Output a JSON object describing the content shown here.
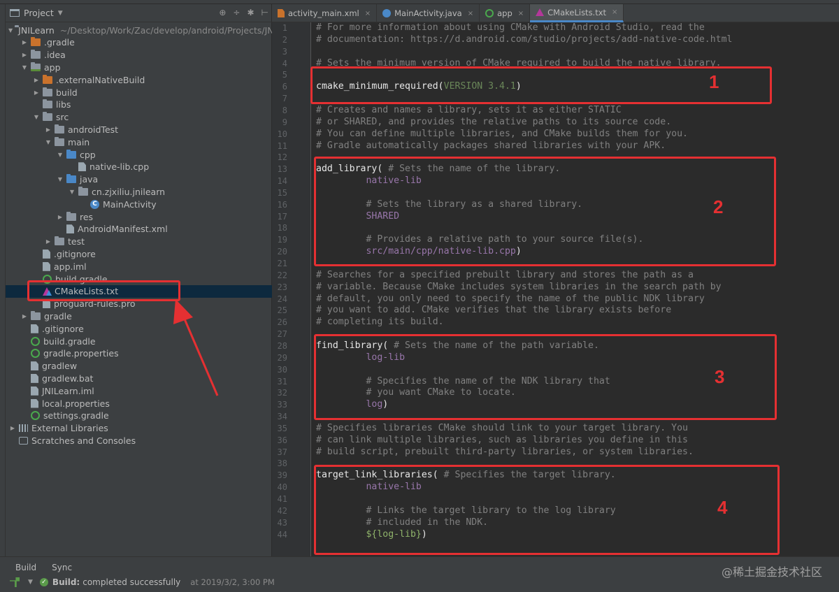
{
  "project_panel": {
    "title": "Project",
    "tools": [
      "⊕",
      "÷",
      "✱",
      "⊢"
    ]
  },
  "tree": [
    {
      "label": "JNILearn",
      "note": "~/Desktop/Work/Zac/develop/android/Projects/JNI",
      "icon": "module-folder-icon",
      "level": 0,
      "arrow": "▼"
    },
    {
      "label": ".gradle",
      "icon": "orange-folder-icon",
      "level": 1,
      "arrow": "▶"
    },
    {
      "label": ".idea",
      "icon": "folder-icon",
      "level": 1,
      "arrow": "▶"
    },
    {
      "label": "app",
      "icon": "module-folder-icon",
      "level": 1,
      "arrow": "▼"
    },
    {
      "label": ".externalNativeBuild",
      "icon": "orange-folder-icon",
      "level": 2,
      "arrow": "▶"
    },
    {
      "label": "build",
      "icon": "folder-icon",
      "level": 2,
      "arrow": "▶"
    },
    {
      "label": "libs",
      "icon": "folder-icon",
      "level": 2,
      "arrow": ""
    },
    {
      "label": "src",
      "icon": "folder-icon",
      "level": 2,
      "arrow": "▼"
    },
    {
      "label": "androidTest",
      "icon": "folder-icon",
      "level": 3,
      "arrow": "▶"
    },
    {
      "label": "main",
      "icon": "folder-icon",
      "level": 3,
      "arrow": "▼"
    },
    {
      "label": "cpp",
      "icon": "blue-folder-icon",
      "level": 4,
      "arrow": "▼"
    },
    {
      "label": "native-lib.cpp",
      "icon": "file-icon",
      "level": 5,
      "arrow": ""
    },
    {
      "label": "java",
      "icon": "blue-folder-icon",
      "level": 4,
      "arrow": "▼"
    },
    {
      "label": "cn.zjxiliu.jnilearn",
      "icon": "folder-icon",
      "level": 5,
      "arrow": "▼"
    },
    {
      "label": "MainActivity",
      "icon": "class-icon",
      "level": 6,
      "arrow": ""
    },
    {
      "label": "res",
      "icon": "folder-icon",
      "level": 4,
      "arrow": "▶"
    },
    {
      "label": "AndroidManifest.xml",
      "icon": "file-icon",
      "level": 4,
      "arrow": ""
    },
    {
      "label": "test",
      "icon": "folder-icon",
      "level": 3,
      "arrow": "▶"
    },
    {
      "label": ".gitignore",
      "icon": "file-icon",
      "level": 2,
      "arrow": ""
    },
    {
      "label": "app.iml",
      "icon": "file-icon",
      "level": 2,
      "arrow": ""
    },
    {
      "label": "build.gradle",
      "icon": "gradle-icon",
      "level": 2,
      "arrow": ""
    },
    {
      "label": "CMakeLists.txt",
      "icon": "cmake-icon",
      "level": 2,
      "arrow": "",
      "selected": true
    },
    {
      "label": "proguard-rules.pro",
      "icon": "file-icon",
      "level": 2,
      "arrow": ""
    },
    {
      "label": "gradle",
      "icon": "folder-icon",
      "level": 1,
      "arrow": "▶"
    },
    {
      "label": ".gitignore",
      "icon": "file-icon",
      "level": 1,
      "arrow": ""
    },
    {
      "label": "build.gradle",
      "icon": "gradle-icon",
      "level": 1,
      "arrow": ""
    },
    {
      "label": "gradle.properties",
      "icon": "gradle-icon",
      "level": 1,
      "arrow": ""
    },
    {
      "label": "gradlew",
      "icon": "file-icon",
      "level": 1,
      "arrow": ""
    },
    {
      "label": "gradlew.bat",
      "icon": "file-icon",
      "level": 1,
      "arrow": ""
    },
    {
      "label": "JNILearn.iml",
      "icon": "file-icon",
      "level": 1,
      "arrow": ""
    },
    {
      "label": "local.properties",
      "icon": "file-icon",
      "level": 1,
      "arrow": ""
    },
    {
      "label": "settings.gradle",
      "icon": "gradle-icon",
      "level": 1,
      "arrow": ""
    },
    {
      "label": "External Libraries",
      "icon": "library-icon",
      "level": 0,
      "arrow": "▶"
    },
    {
      "label": "Scratches and Consoles",
      "icon": "scratch-icon",
      "level": 0,
      "arrow": ""
    }
  ],
  "tabs": [
    {
      "label": "activity_main.xml",
      "icon": "xml-file-icon",
      "active": false
    },
    {
      "label": "MainActivity.java",
      "icon": "class-icon",
      "active": false
    },
    {
      "label": "app",
      "icon": "gradle-icon",
      "active": false
    },
    {
      "label": "CMakeLists.txt",
      "icon": "cmake-icon",
      "active": true
    }
  ],
  "tab_close_glyph": "×",
  "code_lines": [
    [
      [
        "com",
        "# For more information about using CMake with Android Studio, read the"
      ]
    ],
    [
      [
        "com",
        "# documentation: https://d.android.com/studio/projects/add-native-code.html"
      ]
    ],
    [],
    [
      [
        "com",
        "# Sets the minimum version of CMake required to build the native library."
      ]
    ],
    [],
    [
      [
        "cmd",
        "cmake_minimum_required("
      ],
      [
        "ver",
        "VERSION 3.4.1"
      ],
      [
        "cmd",
        ")"
      ]
    ],
    [],
    [
      [
        "com",
        "# Creates and names a library, sets it as either STATIC"
      ]
    ],
    [
      [
        "com",
        "# or SHARED, and provides the relative paths to its source code."
      ]
    ],
    [
      [
        "com",
        "# You can define multiple libraries, and CMake builds them for you."
      ]
    ],
    [
      [
        "com",
        "# Gradle automatically packages shared libraries with your APK."
      ]
    ],
    [],
    [
      [
        "cmd",
        "add_library( "
      ],
      [
        "com",
        "# Sets the name of the library."
      ]
    ],
    [
      [
        "arg",
        "         native-lib"
      ]
    ],
    [],
    [
      [
        "com",
        "         # Sets the library as a shared library."
      ]
    ],
    [
      [
        "arg",
        "         SHARED"
      ]
    ],
    [],
    [
      [
        "com",
        "         # Provides a relative path to your source file(s)."
      ]
    ],
    [
      [
        "arg",
        "         src/main/cpp/native-lib.cpp"
      ],
      [
        "cmd",
        ")"
      ]
    ],
    [],
    [
      [
        "com",
        "# Searches for a specified prebuilt library and stores the path as a"
      ]
    ],
    [
      [
        "com",
        "# variable. Because CMake includes system libraries in the search path by"
      ]
    ],
    [
      [
        "com",
        "# default, you only need to specify the name of the public NDK library"
      ]
    ],
    [
      [
        "com",
        "# you want to add. CMake verifies that the library exists before"
      ]
    ],
    [
      [
        "com",
        "# completing its build."
      ]
    ],
    [],
    [
      [
        "cmd",
        "find_library( "
      ],
      [
        "com",
        "# Sets the name of the path variable."
      ]
    ],
    [
      [
        "arg",
        "         log-lib"
      ]
    ],
    [],
    [
      [
        "com",
        "         # Specifies the name of the NDK library that"
      ]
    ],
    [
      [
        "com",
        "         # you want CMake to locate."
      ]
    ],
    [
      [
        "arg",
        "         log"
      ],
      [
        "cmd",
        ")"
      ]
    ],
    [],
    [
      [
        "com",
        "# Specifies libraries CMake should link to your target library. You"
      ]
    ],
    [
      [
        "com",
        "# can link multiple libraries, such as libraries you define in this"
      ]
    ],
    [
      [
        "com",
        "# build script, prebuilt third-party libraries, or system libraries."
      ]
    ],
    [],
    [
      [
        "cmd",
        "target_link_libraries( "
      ],
      [
        "com",
        "# Specifies the target library."
      ]
    ],
    [
      [
        "arg",
        "         native-lib"
      ]
    ],
    [],
    [
      [
        "com",
        "         # Links the target library to the log library"
      ]
    ],
    [
      [
        "com",
        "         # included in the NDK."
      ]
    ],
    [
      [
        "arg2",
        "         ${log-lib}"
      ],
      [
        "cmd",
        ")"
      ]
    ]
  ],
  "annotations": [
    "1",
    "2",
    "3",
    "4"
  ],
  "bottom": {
    "tabs": [
      "Build",
      "Sync"
    ],
    "status_label": "Build:",
    "status_text": "completed successfully",
    "timestamp": "at 2019/3/2, 3:00 PM",
    "watermark": "@稀土掘金技术社区"
  },
  "colors": {
    "annotation_red": "#e53032",
    "selection": "#0d293e",
    "comment": "#808080"
  }
}
